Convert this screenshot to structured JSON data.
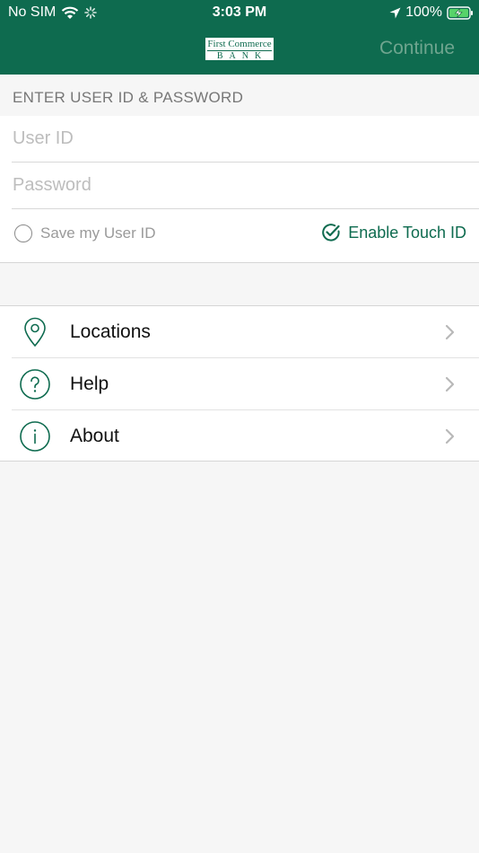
{
  "status_bar": {
    "carrier": "No SIM",
    "time": "3:03 PM",
    "battery": "100%"
  },
  "nav": {
    "logo_line1": "First Commerce",
    "logo_line2": "BANK",
    "continue_label": "Continue"
  },
  "login": {
    "section_label": "ENTER USER ID & PASSWORD",
    "user_id_placeholder": "User ID",
    "password_placeholder": "Password",
    "save_user_id_label": "Save my User ID",
    "enable_touch_id_label": "Enable Touch ID"
  },
  "menu": {
    "items": [
      {
        "label": "Locations",
        "icon": "location-pin-icon"
      },
      {
        "label": "Help",
        "icon": "question-circle-icon"
      },
      {
        "label": "About",
        "icon": "info-circle-icon"
      }
    ]
  },
  "colors": {
    "brand_green": "#0e6b4f",
    "continue_disabled": "#6fa58f",
    "background": "#f6f6f6"
  }
}
